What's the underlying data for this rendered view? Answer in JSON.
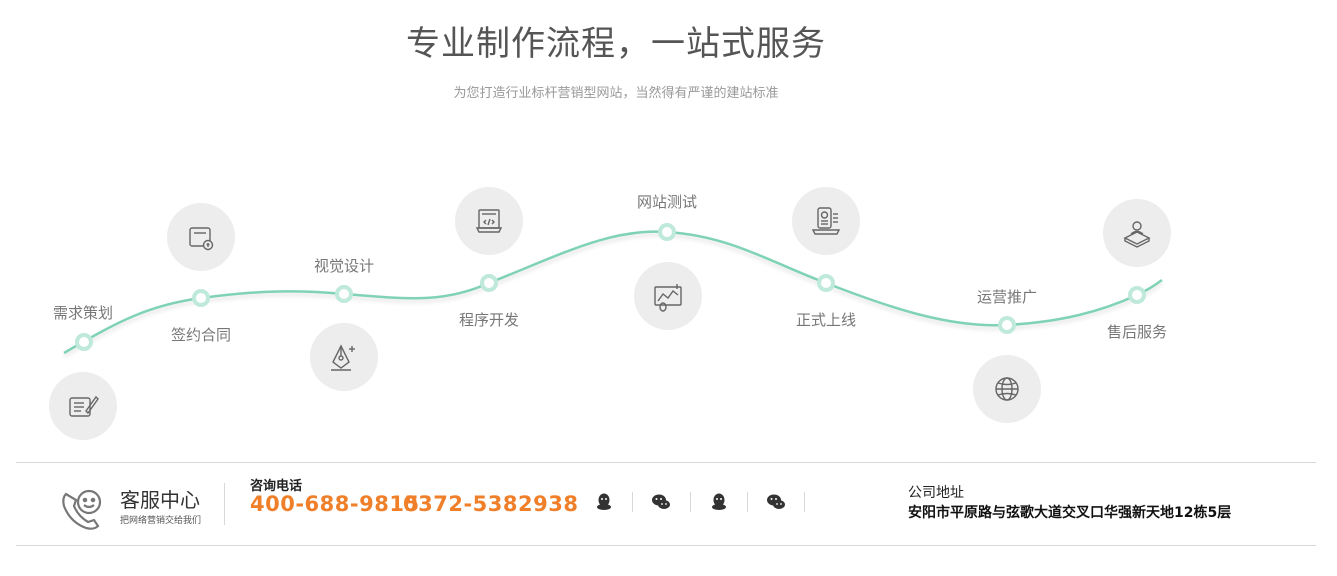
{
  "header": {
    "title": "专业制作流程，一站式服务",
    "subtitle": "为您打造行业标杆营销型网站，当然得有严谨的建站标准"
  },
  "steps": [
    {
      "label": "需求策划",
      "icon": "pen-document-icon"
    },
    {
      "label": "签约合同",
      "icon": "folder-contract-icon"
    },
    {
      "label": "视觉设计",
      "icon": "pen-nib-icon"
    },
    {
      "label": "程序开发",
      "icon": "code-monitor-icon"
    },
    {
      "label": "网站测试",
      "icon": "chart-test-icon"
    },
    {
      "label": "正式上线",
      "icon": "phone-laptop-icon"
    },
    {
      "label": "运营推广",
      "icon": "globe-icon"
    },
    {
      "label": "售后服务",
      "icon": "support-person-icon"
    }
  ],
  "colors": {
    "curve": "#7fd3b4",
    "phone": "#f07f2a",
    "circle_bg": "#ededed"
  },
  "footer": {
    "service_title": "客服中心",
    "service_sub": "把网络营销交给我们",
    "consult_label": "咨询电话",
    "phone1": "400-688-9815",
    "phone2": "0372-5382938",
    "social": [
      "qq-icon",
      "wechat-icon",
      "qq-icon",
      "wechat-icon"
    ],
    "address_label": "公司地址",
    "address_value": "安阳市平原路与弦歌大道交叉口华强新天地12栋5层"
  }
}
